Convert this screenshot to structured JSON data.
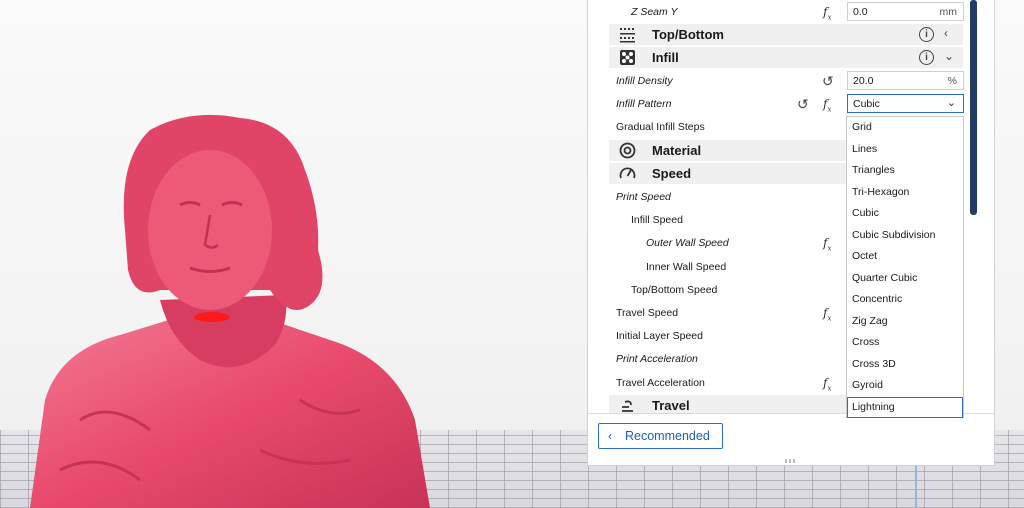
{
  "settings": {
    "z_seam_y": {
      "label": "Z Seam Y",
      "value": "0.0",
      "unit": "mm"
    },
    "top_bottom": {
      "label": "Top/Bottom"
    },
    "infill": {
      "label": "Infill"
    },
    "infill_density": {
      "label": "Infill Density",
      "value": "20.0",
      "unit": "%"
    },
    "infill_pattern": {
      "label": "Infill Pattern",
      "value": "Cubic"
    },
    "gradual_infill_steps": {
      "label": "Gradual Infill Steps"
    },
    "material": {
      "label": "Material"
    },
    "speed": {
      "label": "Speed"
    },
    "print_speed": {
      "label": "Print Speed"
    },
    "infill_speed": {
      "label": "Infill Speed"
    },
    "outer_wall_speed": {
      "label": "Outer Wall Speed"
    },
    "inner_wall_speed": {
      "label": "Inner Wall Speed"
    },
    "top_bottom_speed": {
      "label": "Top/Bottom Speed"
    },
    "travel_speed": {
      "label": "Travel Speed"
    },
    "initial_layer_speed": {
      "label": "Initial Layer Speed"
    },
    "print_acceleration": {
      "label": "Print Acceleration"
    },
    "travel_acceleration": {
      "label": "Travel Acceleration"
    },
    "travel": {
      "label": "Travel"
    }
  },
  "dropdown": {
    "options": [
      "Grid",
      "Lines",
      "Triangles",
      "Tri-Hexagon",
      "Cubic",
      "Cubic Subdivision",
      "Octet",
      "Quarter Cubic",
      "Concentric",
      "Zig Zag",
      "Cross",
      "Cross 3D",
      "Gyroid",
      "Lightning"
    ],
    "highlighted": "Lightning"
  },
  "footer": {
    "recommended_label": "Recommended"
  },
  "icons": {
    "fx": "fx-icon",
    "reset": "reset-icon",
    "info": "info-icon",
    "chevron_left": "chevron-left-icon",
    "chevron_down": "chevron-down-icon",
    "chevron_back": "chevron-left-icon"
  },
  "colors": {
    "model": "#e84a6c",
    "overhang": "#ff1a1a",
    "accent": "#2f6fc1",
    "scrollbar": "#233a63"
  }
}
